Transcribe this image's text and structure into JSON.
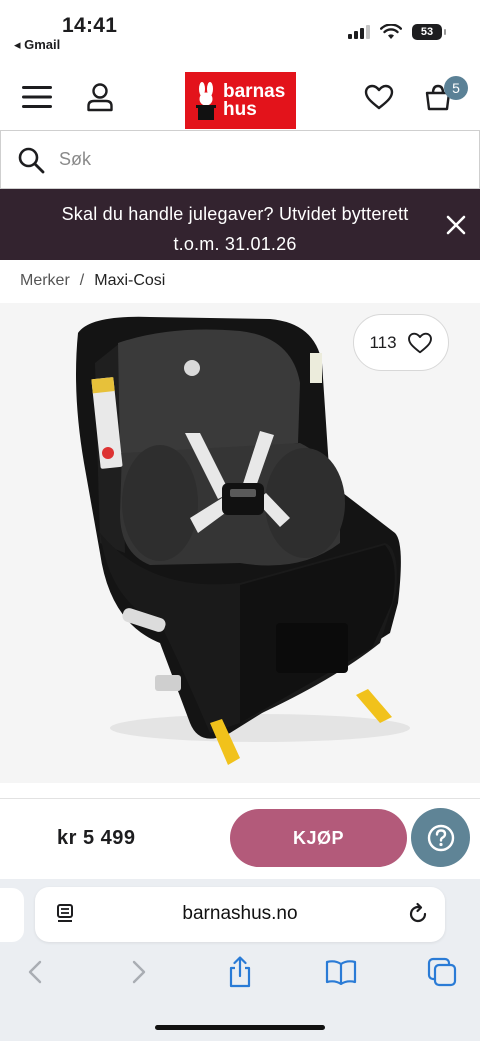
{
  "status_bar": {
    "time": "14:41",
    "back_app": "◂ Gmail",
    "battery": "53",
    "icons": [
      "cellular-signal-icon",
      "wifi-icon",
      "battery-icon"
    ]
  },
  "header": {
    "logo_text": "barnas hus",
    "logo_line1": "barnas",
    "logo_line2": "hus",
    "cart_count": "5",
    "brand_color": "#e3131b",
    "icons": [
      "menu-icon",
      "user-icon",
      "heart-icon",
      "cart-icon"
    ]
  },
  "search": {
    "placeholder": "Søk"
  },
  "promo": {
    "text": "Skal du handle julegaver? Utvidet bytterett t.o.m. 31.01.26",
    "background": "#33232f"
  },
  "breadcrumb": {
    "items": [
      "Merker",
      "Maxi-Cosi"
    ],
    "separator": "/"
  },
  "product": {
    "wishlist_count": "113",
    "image_alt": "Maxi-Cosi car seat"
  },
  "buy_bar": {
    "price": "kr 5 499",
    "buy_label": "KJØP",
    "buy_color": "#b35a7a",
    "help_color": "#5f8496"
  },
  "browser": {
    "address": "barnashus.no",
    "icons": [
      "reader-icon",
      "reload-icon",
      "back-icon",
      "forward-icon",
      "share-icon",
      "bookmarks-icon",
      "tabs-icon"
    ]
  }
}
